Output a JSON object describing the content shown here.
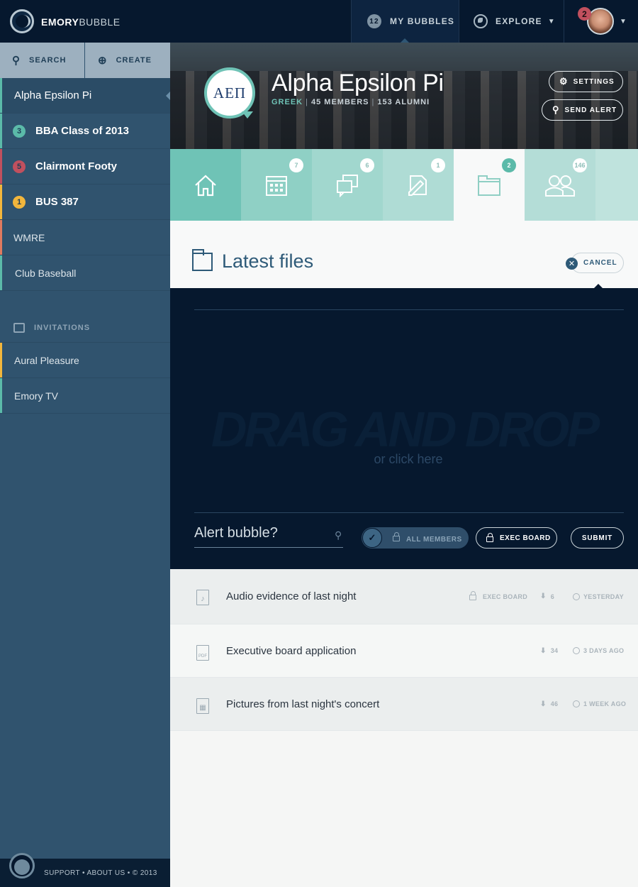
{
  "topbar": {
    "brand_bold": "EMORY",
    "brand_light": "BUBBLE",
    "my_bubbles_count": "12",
    "my_bubbles_label": "MY BUBBLES",
    "explore_label": "EXPLORE",
    "notification_count": "2"
  },
  "sidebar": {
    "search_label": "SEARCH",
    "create_label": "CREATE",
    "items": [
      {
        "label": "Alpha Epsilon Pi",
        "count": "",
        "bar_color": "#5bbaa9"
      },
      {
        "label": "BBA Class of 2013",
        "count": "3",
        "bar_color": "#5bbaa9",
        "badge_color": "#5bbaa9"
      },
      {
        "label": "Clairmont Footy",
        "count": "5",
        "bar_color": "#c1505e",
        "badge_color": "#c1505e"
      },
      {
        "label": "BUS 387",
        "count": "1",
        "bar_color": "#f2b63c",
        "badge_color": "#f2b63c"
      },
      {
        "label": "WMRE",
        "count": "",
        "bar_color": "#e07a5f"
      },
      {
        "label": "Club Baseball",
        "count": "",
        "bar_color": "#5bbaa9"
      }
    ],
    "invitations_label": "INVITATIONS",
    "invitations": [
      {
        "label": "Aural Pleasure",
        "bar_color": "#f2b63c"
      },
      {
        "label": "Emory TV",
        "bar_color": "#5bbaa9"
      }
    ],
    "footer_text": "SUPPORT • ABOUT US • © 2013"
  },
  "group": {
    "crest": "ΑΕΠ",
    "name": "Alpha Epsilon Pi",
    "category": "GREEK",
    "members": "45 MEMBERS",
    "alumni": "153 ALUMNI",
    "settings_label": "SETTINGS",
    "send_alert_label": "SEND ALERT"
  },
  "tabs": [
    {
      "name": "home",
      "count": "",
      "bg": "#6fc3b6"
    },
    {
      "name": "calendar",
      "count": "7",
      "bg": "#8fd0c5"
    },
    {
      "name": "discussions",
      "count": "6",
      "bg": "#a1d7ce"
    },
    {
      "name": "notes",
      "count": "1",
      "bg": "#afdcd5"
    },
    {
      "name": "files",
      "count": "2",
      "bg": "#f8f9f9"
    },
    {
      "name": "members",
      "count": "146",
      "bg": "#b4ddd7"
    }
  ],
  "files_panel": {
    "title": "Latest files",
    "cancel_label": "CANCEL",
    "drop_title": "DRAG AND DROP",
    "drop_sub": "or click here",
    "alert_question": "Alert bubble?",
    "all_members_label": "ALL MEMBERS",
    "exec_board_label": "EXEC BOARD",
    "submit_label": "SUBMIT"
  },
  "files": [
    {
      "name": "Audio evidence of last night",
      "icon": "audio-file-icon",
      "glyph": "♪",
      "restriction": "EXEC BOARD",
      "downloads": "6",
      "time": "YESTERDAY"
    },
    {
      "name": "Executive board application",
      "icon": "pdf-file-icon",
      "glyph": "PDF",
      "restriction": "",
      "downloads": "34",
      "time": "3 DAYS AGO"
    },
    {
      "name": "Pictures from last night's concert",
      "icon": "image-file-icon",
      "glyph": "▦",
      "restriction": "",
      "downloads": "46",
      "time": "1 WEEK AGO"
    }
  ]
}
